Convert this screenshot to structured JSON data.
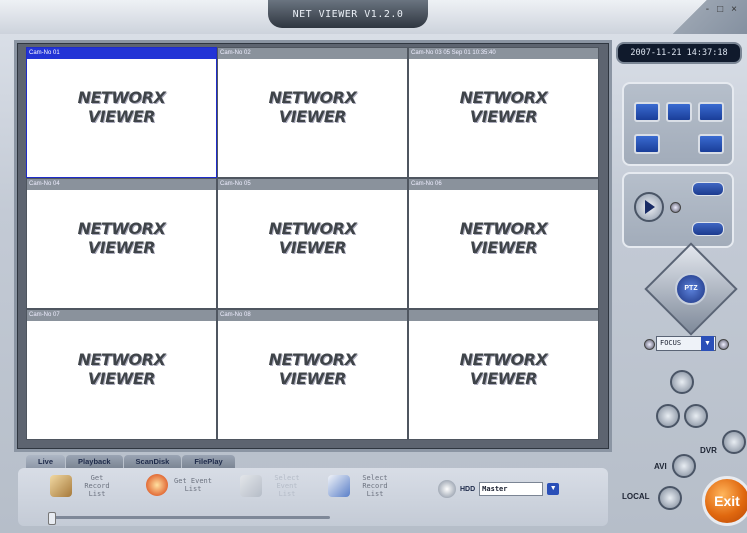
{
  "app": {
    "title": "NET VIEWER V1.2.0"
  },
  "window_controls": {
    "minimize": "-",
    "maximize": "□",
    "close": "×"
  },
  "cameras": [
    {
      "header": "Cam-No 01",
      "line1": "NETWORX",
      "line2": "VIEWER",
      "selected": true
    },
    {
      "header": "Cam-No 02",
      "line1": "NETWORX",
      "line2": "VIEWER",
      "selected": false
    },
    {
      "header": "Cam-No 03 05 Sep 01 10:35:40",
      "line1": "NETWORX",
      "line2": "VIEWER",
      "selected": false
    },
    {
      "header": "Cam-No 04",
      "line1": "NETWORX",
      "line2": "VIEWER",
      "selected": false
    },
    {
      "header": "Cam-No 05",
      "line1": "NETWORX",
      "line2": "VIEWER",
      "selected": false
    },
    {
      "header": "Cam-No 06",
      "line1": "NETWORX",
      "line2": "VIEWER",
      "selected": false
    },
    {
      "header": "Cam-No 07",
      "line1": "NETWORX",
      "line2": "VIEWER",
      "selected": false
    },
    {
      "header": "Cam-No 08",
      "line1": "NETWORX",
      "line2": "VIEWER",
      "selected": false
    },
    {
      "header": "",
      "line1": "NETWORX",
      "line2": "VIEWER",
      "selected": false
    }
  ],
  "tabs": [
    "Live",
    "Playback",
    "ScanDisk",
    "FilePlay"
  ],
  "toolbar": {
    "get_record_list": "Get Record List",
    "get_event_list": "Get Event List",
    "select_event_list": "Select Event List",
    "select_record_list": "Select Record List",
    "hdd_label": "HDD",
    "hdd_value": "Master"
  },
  "right_panel": {
    "clock": "2007-11-21 14:37:18",
    "ptz_label": "PTZ",
    "focus_value": "FOCUS",
    "avi_label": "AVI",
    "dvr_label": "DVR",
    "local_label": "LOCAL",
    "exit_label": "Exit"
  },
  "colors": {
    "selected_header": "#2234d6",
    "exit": "#e0680f",
    "accent_blue": "#2a4fb8"
  }
}
